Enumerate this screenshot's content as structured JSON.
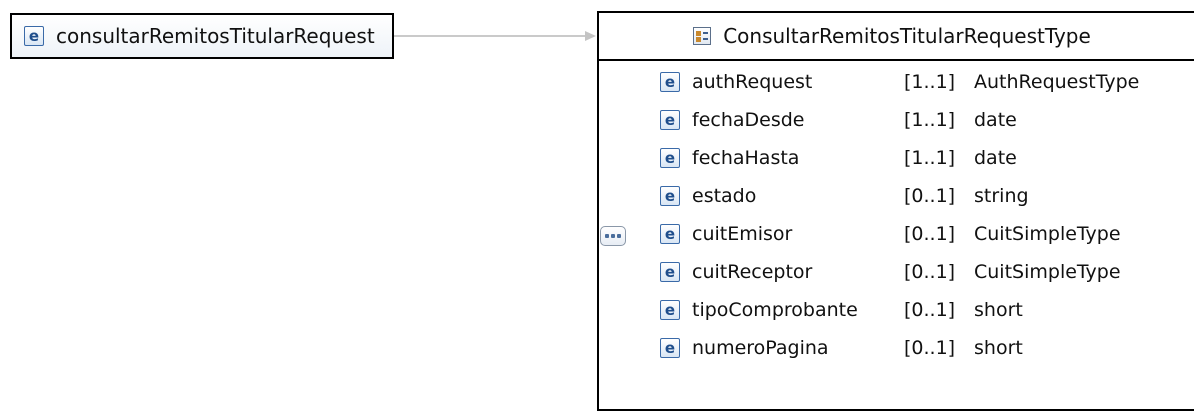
{
  "root_element": {
    "name": "consultarRemitosTitularRequest",
    "icon": "element-icon"
  },
  "complex_type": {
    "name": "ConsultarRemitosTitularRequestType",
    "icon": "complex-type-icon",
    "compositor": "sequence",
    "elements": [
      {
        "name": "authRequest",
        "cardinality": "[1..1]",
        "type": "AuthRequestType"
      },
      {
        "name": "fechaDesde",
        "cardinality": "[1..1]",
        "type": "date"
      },
      {
        "name": "fechaHasta",
        "cardinality": "[1..1]",
        "type": "date"
      },
      {
        "name": "estado",
        "cardinality": "[0..1]",
        "type": "string"
      },
      {
        "name": "cuitEmisor",
        "cardinality": "[0..1]",
        "type": "CuitSimpleType"
      },
      {
        "name": "cuitReceptor",
        "cardinality": "[0..1]",
        "type": "CuitSimpleType"
      },
      {
        "name": "tipoComprobante",
        "cardinality": "[0..1]",
        "type": "short"
      },
      {
        "name": "numeroPagina",
        "cardinality": "[0..1]",
        "type": "short"
      }
    ]
  },
  "element_badge": "e",
  "colors": {
    "border": "#000000",
    "connector": "#b5b5b5",
    "badge": "#1f4e8c"
  }
}
